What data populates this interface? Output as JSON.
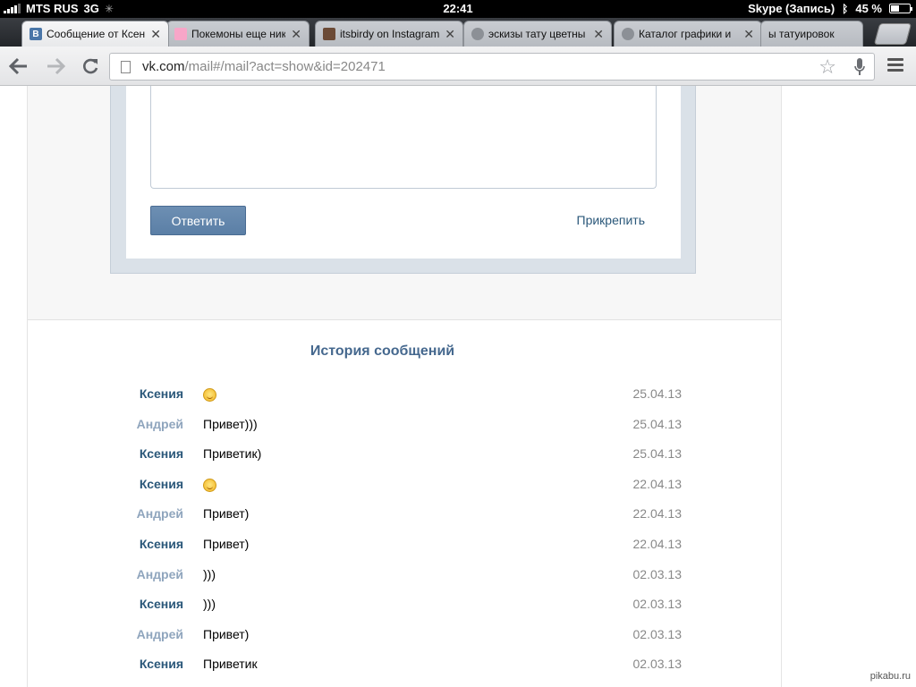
{
  "status_bar": {
    "carrier": "MTS RUS",
    "network": "3G",
    "time": "22:41",
    "app_status": "Skype (Запись)",
    "battery_percent_label": "45 %",
    "battery_level": 0.45
  },
  "tabs": [
    {
      "title": "Сообщение от Ксен",
      "favicon": "vk-icon",
      "active": true
    },
    {
      "title": "Покемоны еще нико",
      "favicon": "pokemon-icon",
      "active": false
    },
    {
      "title": "itsbirdy on Instagram",
      "favicon": "instagram-icon",
      "active": false
    },
    {
      "title": "эскизы тату цветны",
      "favicon": "globe-icon",
      "active": false
    },
    {
      "title": "Каталог графики и",
      "favicon": "globe-icon",
      "active": false
    },
    {
      "title": "ы татуировок",
      "favicon": "",
      "active": false
    }
  ],
  "address_bar": {
    "host": "vk.com",
    "path": "/mail#/mail?act=show&id=202471"
  },
  "reply": {
    "button_label": "Ответить",
    "attach_label": "Прикрепить"
  },
  "history": {
    "title": "История сообщений",
    "messages": [
      {
        "author": "Ксения",
        "text": "",
        "emoji": true,
        "date": "25.04.13",
        "other": false
      },
      {
        "author": "Андрей",
        "text": "Привет)))",
        "emoji": false,
        "date": "25.04.13",
        "other": true
      },
      {
        "author": "Ксения",
        "text": "Приветик)",
        "emoji": false,
        "date": "25.04.13",
        "other": false
      },
      {
        "author": "Ксения",
        "text": "",
        "emoji": true,
        "date": "22.04.13",
        "other": false
      },
      {
        "author": "Андрей",
        "text": "Привет)",
        "emoji": false,
        "date": "22.04.13",
        "other": true
      },
      {
        "author": "Ксения",
        "text": "Привет)",
        "emoji": false,
        "date": "22.04.13",
        "other": false
      },
      {
        "author": "Андрей",
        "text": ")))",
        "emoji": false,
        "date": "02.03.13",
        "other": true
      },
      {
        "author": "Ксения",
        "text": ")))",
        "emoji": false,
        "date": "02.03.13",
        "other": false
      },
      {
        "author": "Андрей",
        "text": "Привет)",
        "emoji": false,
        "date": "02.03.13",
        "other": true
      },
      {
        "author": "Ксения",
        "text": "Приветик",
        "emoji": false,
        "date": "02.03.13",
        "other": false
      }
    ]
  },
  "watermark": "pikabu.ru",
  "colors": {
    "vk_blue": "#45688e",
    "link": "#2b587a",
    "author_other": "#8fa5bd"
  }
}
